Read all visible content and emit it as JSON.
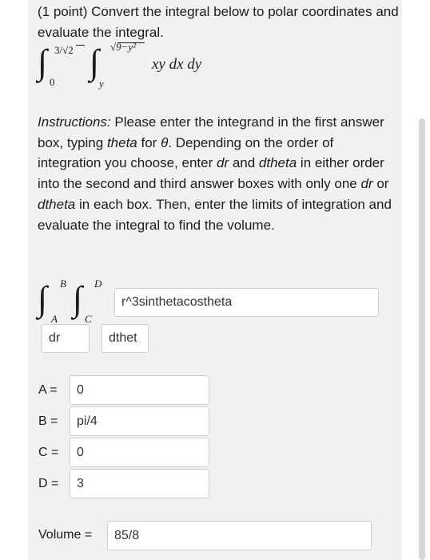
{
  "problem": {
    "header": "(1 point) Convert the integral below to polar coordinates and evaluate the integral.",
    "integral": {
      "outer_upper": "3/√2",
      "outer_lower": "0",
      "inner_upper": "√9−y²",
      "inner_lower": "y",
      "integrand": "xy dx dy"
    },
    "instructions": [
      {
        "t": "Instructions:",
        "i": true
      },
      {
        "t": " Please enter the integrand in the first answer box, typing ",
        "i": false
      },
      {
        "t": "theta",
        "i": true
      },
      {
        "t": " for ",
        "i": false
      },
      {
        "t": "θ",
        "i": true
      },
      {
        "t": ". Depending on the order of integration you choose, enter ",
        "i": false
      },
      {
        "t": "dr",
        "i": true
      },
      {
        "t": " and ",
        "i": false
      },
      {
        "t": "dtheta",
        "i": true
      },
      {
        "t": " in either order into the second and third answer boxes with only one ",
        "i": false
      },
      {
        "t": "dr",
        "i": true
      },
      {
        "t": " or ",
        "i": false
      },
      {
        "t": "dtheta",
        "i": true
      },
      {
        "t": " in each box. Then, enter the limits of integration and evaluate the integral to find the volume.",
        "i": false
      }
    ]
  },
  "answer": {
    "limit_upper_outer": "B",
    "limit_lower_outer": "A",
    "limit_upper_inner": "D",
    "limit_lower_inner": "C",
    "integrand_value": "r^3sinthetacostheta",
    "diff1_value": "dr",
    "diff2_value": "dthet",
    "A_label": "A =",
    "A_value": "0",
    "B_label": "B =",
    "B_value": "pi/4",
    "C_label": "C =",
    "C_value": "0",
    "D_label": "D =",
    "D_value": "3",
    "volume_label": "Volume =",
    "volume_value": "85/8"
  }
}
